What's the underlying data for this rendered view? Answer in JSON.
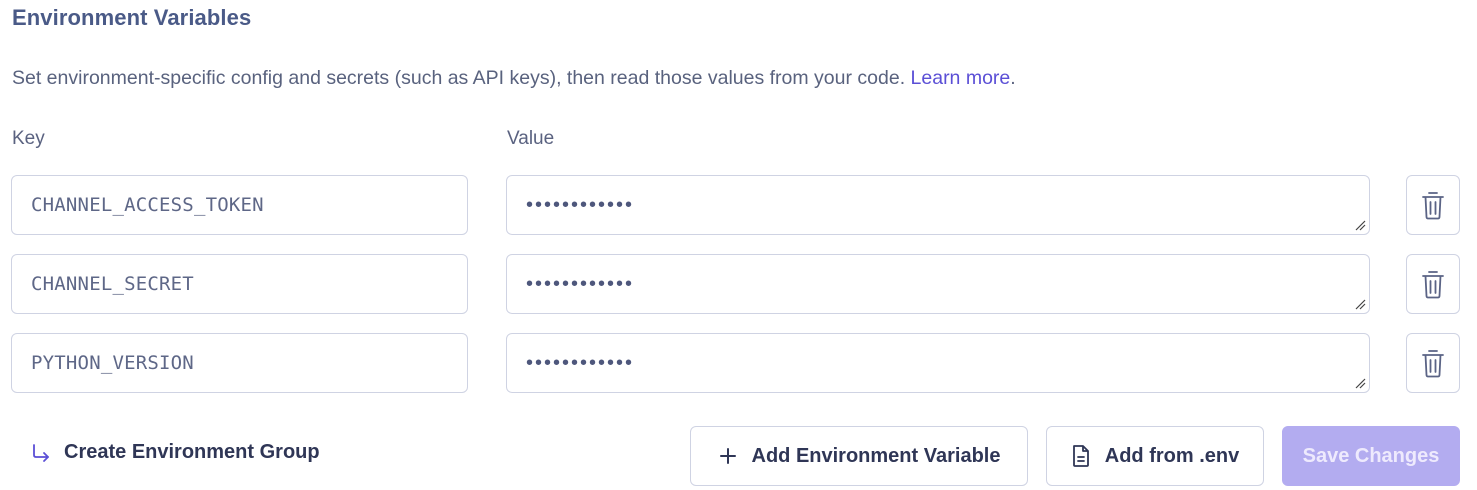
{
  "section": {
    "title": "Environment Variables",
    "description": "Set environment-specific config and secrets (such as API keys), then read those values from your code.",
    "learn_more": "Learn more",
    "period": "."
  },
  "columns": {
    "key": "Key",
    "value": "Value"
  },
  "env_vars": [
    {
      "key": "CHANNEL_ACCESS_TOKEN",
      "value_masked": "••••••••••••"
    },
    {
      "key": "CHANNEL_SECRET",
      "value_masked": "••••••••••••"
    },
    {
      "key": "PYTHON_VERSION",
      "value_masked": "••••••••••••"
    }
  ],
  "actions": {
    "create_group": "Create Environment Group",
    "add_variable": "Add Environment Variable",
    "add_from_env": "Add from .env",
    "save": "Save Changes"
  },
  "icons": {
    "delete": "trash-icon",
    "add": "plus-icon",
    "file": "file-icon",
    "create_group": "arrow-turn-down-right-icon"
  },
  "colors": {
    "accent": "#5b4fd6",
    "save_disabled_bg": "#b3acf0",
    "border": "#cfd3e3"
  }
}
